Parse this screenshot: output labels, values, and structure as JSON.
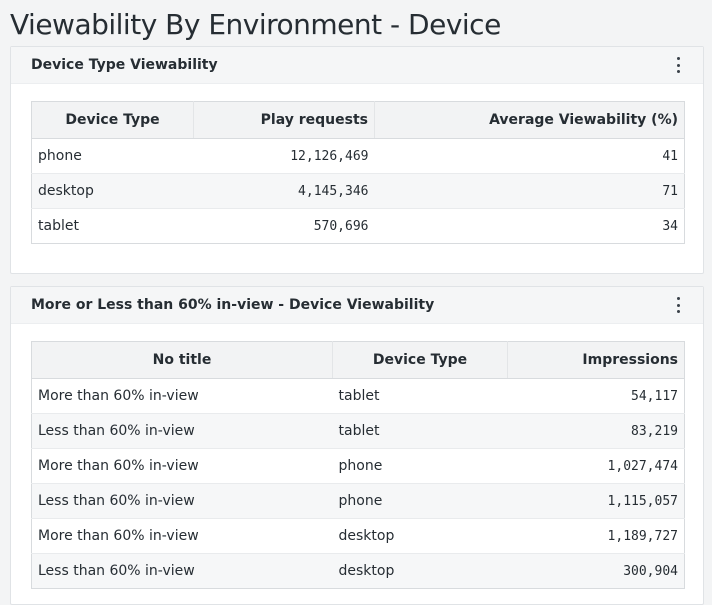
{
  "page": {
    "title": "Viewability By Environment - Device"
  },
  "card1": {
    "title": "Device Type Viewability",
    "menu_icon": "more-vertical-icon",
    "columns": [
      "Device Type",
      "Play requests",
      "Average Viewability (%)"
    ],
    "rows": [
      [
        "phone",
        "12,126,469",
        "41"
      ],
      [
        "desktop",
        "4,145,346",
        "71"
      ],
      [
        "tablet",
        "570,696",
        "34"
      ]
    ]
  },
  "card2": {
    "title": "More or Less than 60% in-view - Device Viewability",
    "menu_icon": "more-vertical-icon",
    "columns": [
      "No title",
      "Device Type",
      "Impressions"
    ],
    "rows": [
      [
        "More than 60% in-view",
        "tablet",
        "54,117"
      ],
      [
        "Less than 60% in-view",
        "tablet",
        "83,219"
      ],
      [
        "More than 60% in-view",
        "phone",
        "1,027,474"
      ],
      [
        "Less than 60% in-view",
        "phone",
        "1,115,057"
      ],
      [
        "More than 60% in-view",
        "desktop",
        "1,189,727"
      ],
      [
        "Less than 60% in-view",
        "desktop",
        "300,904"
      ]
    ]
  },
  "colors": {
    "background": "#f3f4f5",
    "card": "#ffffff",
    "header": "#f5f6f7",
    "text": "#262d33"
  }
}
